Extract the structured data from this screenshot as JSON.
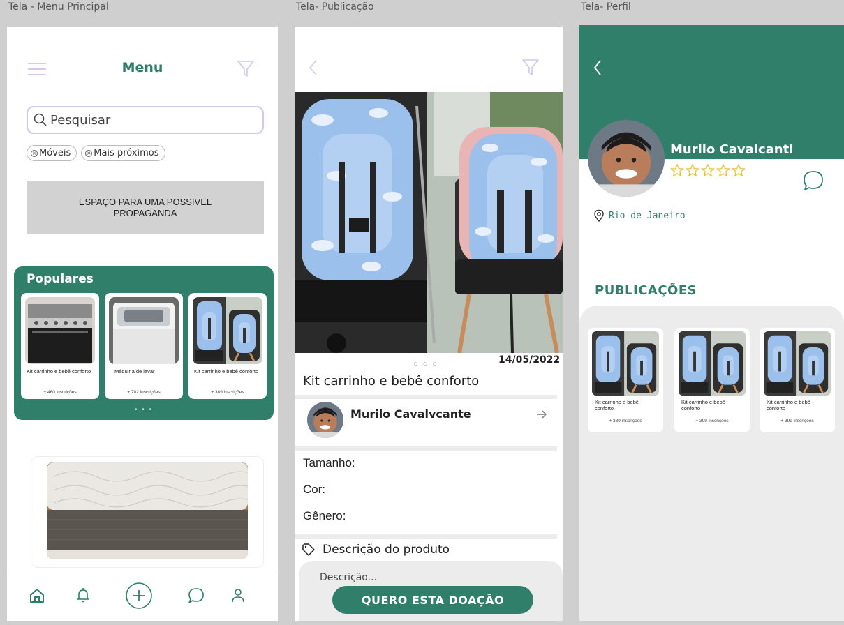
{
  "screens": {
    "menu": {
      "label": "Tela - Menu  Principal",
      "title": "Menu",
      "search_placeholder": "Pesquisar",
      "chips": [
        "Móveis",
        "Mais próximos"
      ],
      "ad_text": "ESPAÇO PARA UMA POSSIVEL PROPAGANDA",
      "popular_title": "Populares",
      "popular_items": [
        {
          "name": "Kit carrinho e bebê conforto",
          "subs": "+ 460 inscrições"
        },
        {
          "name": "Máquina de lavar",
          "subs": "+ 702 inscrições"
        },
        {
          "name": "Kit carrinho e bebê conforto",
          "subs": "+ 389 inscrições"
        }
      ],
      "carousel_dots": "• • •",
      "nav_icons": [
        "home-icon",
        "bell-icon",
        "plus-circle-icon",
        "chat-icon",
        "user-icon"
      ]
    },
    "publicacao": {
      "label": "Tela- Publicação",
      "carousel_dots": "○○○",
      "date": "14/05/2022",
      "title": "Kit carrinho e bebê conforto",
      "seller_name": "Murilo Cavalvcante",
      "fields": [
        "Tamanho:",
        "Cor:",
        "Gênero:"
      ],
      "description_title": "Descrição do produto",
      "description_placeholder": "Descrição...",
      "cta": "QUERO ESTA DOAÇÃO"
    },
    "perfil": {
      "label": "Tela- Perfil",
      "name": "Murilo Cavalcanti",
      "rating_stars": 5,
      "location": "Rio de Janeiro",
      "publications_title": "PUBLICAÇÕES",
      "items": [
        {
          "name": "Kit carrinho e bebê conforto",
          "subs": "+ 389 inscrições"
        },
        {
          "name": "Kit carrinho e bebê conforto",
          "subs": "+ 399 inscrições"
        },
        {
          "name": "Kit carrinho e bebê conforto",
          "subs": "+ 399 inscrições"
        }
      ]
    }
  },
  "colors": {
    "accent": "#2f7f6b",
    "soft_purple": "#d2c6ea",
    "gray_bg": "#ececec",
    "seat_blue": "#9cc0ec"
  }
}
